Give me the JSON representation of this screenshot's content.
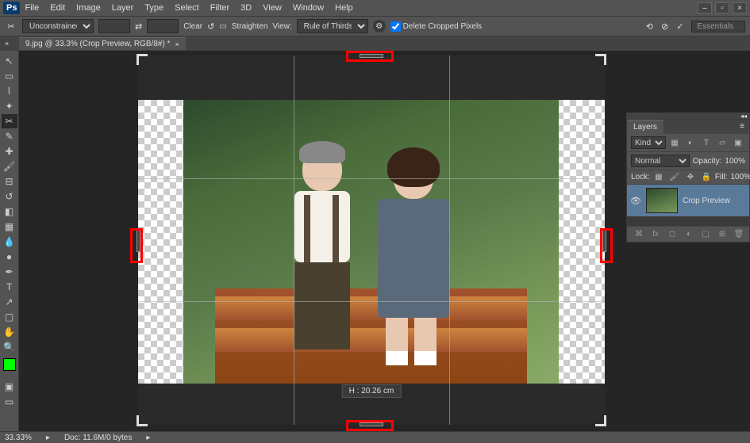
{
  "logo": "Ps",
  "menu": [
    "File",
    "Edit",
    "Image",
    "Layer",
    "Type",
    "Select",
    "Filter",
    "3D",
    "View",
    "Window",
    "Help"
  ],
  "options": {
    "ratio_mode": "Unconstrained",
    "swap": "⇄",
    "clear": "Clear",
    "straighten": "Straighten",
    "view_label": "View:",
    "overlay": "Rule of Thirds",
    "delete_cropped": "Delete Cropped Pixels",
    "workspace": "Essentials"
  },
  "doc_tab": "9.jpg @ 33.3% (Crop Preview, RGB/8#) *",
  "dim_readout": "H :   20.26 cm",
  "status": {
    "zoom": "33.33%",
    "doc": "Doc: 11.6M/0 bytes"
  },
  "layers": {
    "title": "Layers",
    "kind": "Kind",
    "blend": "Normal",
    "opacity_label": "Opacity:",
    "opacity_val": "100%",
    "lock_label": "Lock:",
    "fill_label": "Fill:",
    "fill_val": "100%",
    "layer_name": "Crop Preview"
  }
}
